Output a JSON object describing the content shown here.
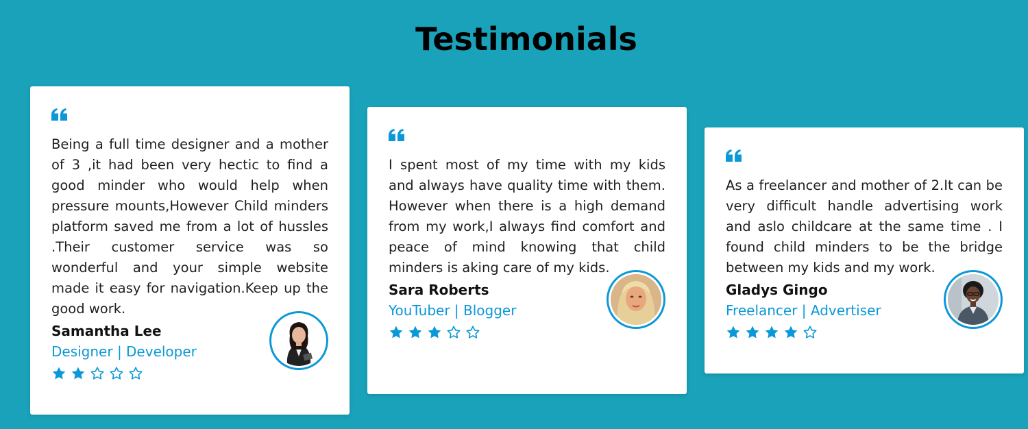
{
  "section": {
    "title": "Testimonials"
  },
  "colors": {
    "background": "#19a2b9",
    "accent": "#0b98d8",
    "card": "#ffffff"
  },
  "testimonials": [
    {
      "quote_icon": "quote-icon",
      "text": "Being a full time designer and a mother of 3 ,it had been very hectic to find a good minder who would help when pressure mounts,However Child minders platform saved me from a lot of hussles .Their customer service was so wonderful and your simple website made it easy for navigation.Keep up the good work.",
      "name": "Samantha Lee",
      "role": "Designer | Developer",
      "rating": 2,
      "rating_max": 5,
      "avatar": "avatar-photo"
    },
    {
      "quote_icon": "quote-icon",
      "text": "I spent most of my time with my kids and always have quality time with them. However when there is a high demand from my work,I always find comfort and peace of mind knowing that child minders is aking care of my kids.",
      "name": "Sara Roberts",
      "role": "YouTuber | Blogger",
      "rating": 3,
      "rating_max": 5,
      "avatar": "avatar-photo"
    },
    {
      "quote_icon": "quote-icon",
      "text": "As a freelancer and mother of 2.It can be very difficult handle advertising work and aslo childcare at the same time . I found child minders to be the bridge between my kids and my work.",
      "name": "Gladys Gingo",
      "role": "Freelancer | Advertiser",
      "rating": 4,
      "rating_max": 5,
      "avatar": "avatar-photo"
    }
  ]
}
